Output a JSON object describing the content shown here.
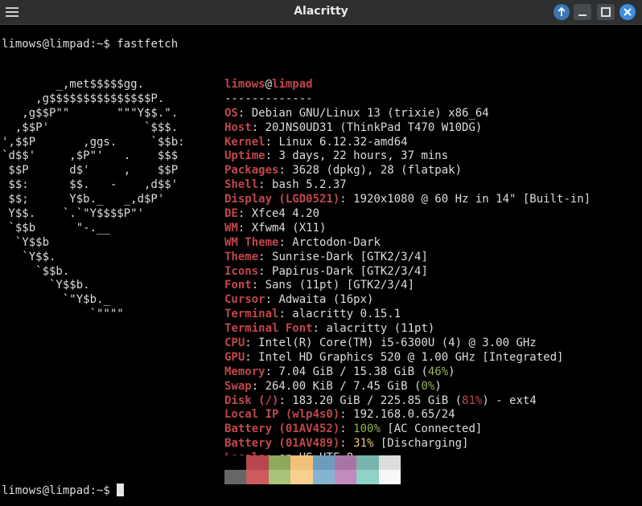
{
  "window": {
    "title": "Alacritty"
  },
  "prompt": {
    "user": "limows@limpad:~$ ",
    "command": "fastfetch"
  },
  "logo_lines": [
    "        _,met$$$$$gg.",
    "     ,g$$$$$$$$$$$$$$$P.",
    "   ,g$$P\"\"       \"\"\"Y$$.\".",
    "  ,$$P'              `$$$.",
    "',$$P       ,ggs.     `$$b:",
    "`d$$'     ,$P\"'   .    $$$",
    " $$P      d$'     ,    $$P",
    " $$:      $$.   -    ,d$$'",
    " $$;      Y$b._   _,d$P'",
    " Y$$.    `.`\"Y$$$$P\"'",
    " `$$b      \"-.__",
    "  `Y$$b",
    "   `Y$$.",
    "     `$$b.",
    "       `Y$$b.",
    "         `\"Y$b._",
    "             `\"\"\"\""
  ],
  "header": {
    "user": "limows",
    "at": "@",
    "host": "limpad",
    "separator": "-------------"
  },
  "info": [
    {
      "key": "OS",
      "value": "Debian GNU/Linux 13 (trixie) x86_64"
    },
    {
      "key": "Host",
      "value": "20JNS0UD31 (ThinkPad T470 W10DG)"
    },
    {
      "key": "Kernel",
      "value": "Linux 6.12.32-amd64"
    },
    {
      "key": "Uptime",
      "value": "3 days, 22 hours, 37 mins"
    },
    {
      "key": "Packages",
      "value": "3628 (dpkg), 28 (flatpak)"
    },
    {
      "key": "Shell",
      "value": "bash 5.2.37"
    },
    {
      "key": "Display (LGD0521)",
      "value": "1920x1080 @ 60 Hz in 14\" [Built-in]"
    },
    {
      "key": "DE",
      "value": "Xfce4 4.20"
    },
    {
      "key": "WM",
      "value": "Xfwm4 (X11)"
    },
    {
      "key": "WM Theme",
      "value": "Arctodon-Dark"
    },
    {
      "key": "Theme",
      "value": "Sunrise-Dark [GTK2/3/4]"
    },
    {
      "key": "Icons",
      "value": "Papirus-Dark [GTK2/3/4]"
    },
    {
      "key": "Font",
      "value": "Sans (11pt) [GTK2/3/4]"
    },
    {
      "key": "Cursor",
      "value": "Adwaita (16px)"
    },
    {
      "key": "Terminal",
      "value": "alacritty 0.15.1"
    },
    {
      "key": "Terminal Font",
      "value": "alacritty (11pt)"
    },
    {
      "key": "CPU",
      "value": "Intel(R) Core(TM) i5-6300U (4) @ 3.00 GHz"
    },
    {
      "key": "GPU",
      "value": "Intel HD Graphics 520 @ 1.00 GHz [Integrated]"
    }
  ],
  "memory": {
    "key": "Memory",
    "value": "7.04 GiB / 15.38 GiB",
    "percent": "46%"
  },
  "swap": {
    "key": "Swap",
    "value": "264.00 KiB / 7.45 GiB",
    "percent": "0%"
  },
  "disk": {
    "key": "Disk (/)",
    "value": "183.20 GiB / 225.85 GiB",
    "percent": "81%",
    "suffix": " - ext4"
  },
  "local_ip": {
    "key": "Local IP (wlp4s0)",
    "value": "192.168.0.65/24"
  },
  "battery1": {
    "key": "Battery (01AV452)",
    "percent": "100%",
    "status": " [AC Connected]"
  },
  "battery2": {
    "key": "Battery (01AV489)",
    "percent": "31%",
    "status": " [Discharging]"
  },
  "locale": {
    "key": "Locale",
    "value": "en_US.UTF-8"
  },
  "palette": {
    "normal": [
      "#000000",
      "#b5474d",
      "#8fa85c",
      "#f2c27a",
      "#6b9cbe",
      "#a775a3",
      "#79b3ad",
      "#dcdcdc"
    ],
    "bright": [
      "#666666",
      "#cc5a5f",
      "#a9c47a",
      "#f8cf8c",
      "#85b4d0",
      "#c28bbd",
      "#8fd2c6",
      "#f8f8f8"
    ]
  },
  "prompt2": {
    "user": "limows@limpad:~$ "
  }
}
